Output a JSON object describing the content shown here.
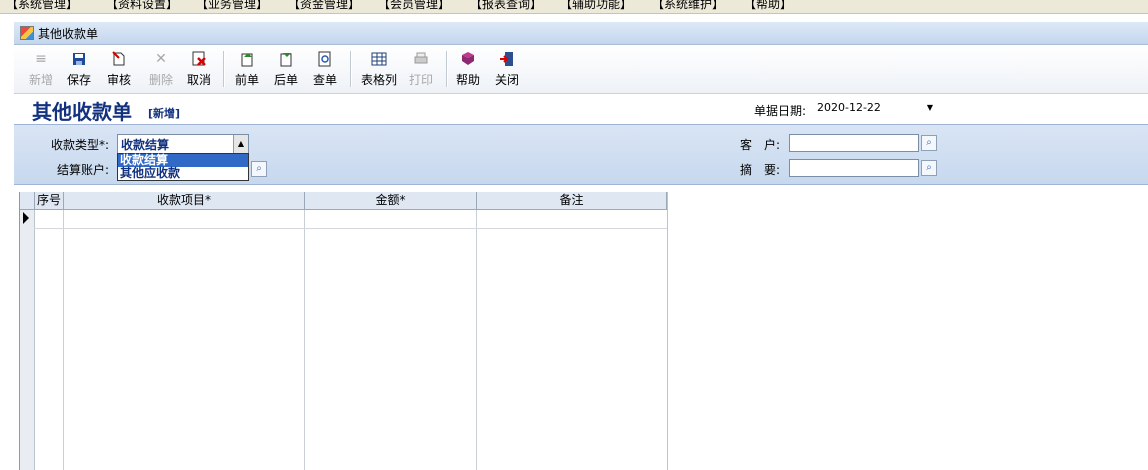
{
  "menu": [
    "【系统管理】",
    "【资料设置】",
    "【业务管理】",
    "【资金管理】",
    "【会员管理】",
    "【报表查询】",
    "【辅助功能】",
    "【系统维护】",
    "【帮助】"
  ],
  "window": {
    "title": "其他收款单"
  },
  "toolbar": {
    "new": "新增",
    "save": "保存",
    "audit": "审核",
    "delete": "删除",
    "cancel": "取消",
    "prev": "前单",
    "next": "后单",
    "find": "查单",
    "grid_cols": "表格列",
    "print": "打印",
    "help": "帮助",
    "close": "关闭"
  },
  "header": {
    "title": "其他收款单",
    "status": "[新增]",
    "date_label": "单据日期:",
    "date_value": "2020-12-22"
  },
  "form": {
    "type_label": "收款类型*:",
    "type_value": "收款结算",
    "type_options": [
      "收款结算",
      "其他应收款"
    ],
    "account_label": "结算账户:",
    "customer_label": "客　户:",
    "customer_value": "",
    "summary_label": "摘　要:",
    "summary_value": ""
  },
  "grid": {
    "headers": [
      "序号",
      "收款项目*",
      "金额*",
      "备注"
    ]
  },
  "colors": {
    "title_blue": "#12317f",
    "selection_blue": "#3169c6",
    "panel_blue": "#c7d8ee"
  }
}
